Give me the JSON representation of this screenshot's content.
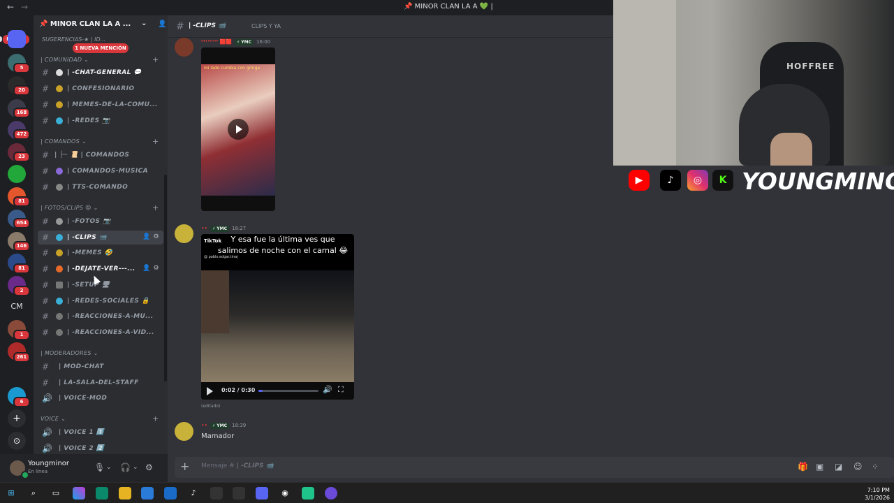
{
  "window": {
    "title": "📌 MINOR CLAN LA A 💚 |"
  },
  "rail": {
    "new_label": "NUEVO",
    "badges": [
      "5",
      "20",
      "168",
      "472",
      "23",
      "81",
      "654",
      "146",
      "81",
      "2",
      "1",
      "261",
      "6"
    ],
    "cm_label": "CM"
  },
  "server": {
    "name": "📌 MINOR CLAN LA A ...",
    "mention_badge": "1 NUEVA MENCIÓN"
  },
  "sidebar": {
    "top_partial": "SUGERENCIAS-★ | ID...",
    "categories": [
      {
        "name": "| COMUNIDAD",
        "channels": [
          "| -CHAT-GENERAL 💬",
          "| CONFESIONARIO",
          "| MEMES-DE-LA-COMU...",
          "| -REDES 📷"
        ]
      },
      {
        "name": "| COMANDOS",
        "channels": [
          "| ├─ 📜 | COMANDOS",
          "| COMANDOS-MUSICA",
          "| TTS-COMANDO"
        ]
      },
      {
        "name": "| FOTOS/CLIPS 😡",
        "channels": [
          "| -FOTOS 📷",
          "| -CLIPS 📹",
          "| -MEMES 🤣",
          "| -DEJATE-VER---...",
          "| -SETUP 🖥",
          "| -REDES-SOCIALES 🔒",
          "| -REACCIONES-A-MU...",
          "| -REACCIONES-A-VID..."
        ]
      },
      {
        "name": "| MODERADORES",
        "channels": [
          "| MOD-CHAT",
          "| LA-SALA-DEL-STAFF",
          "| VOICE-MOD"
        ]
      },
      {
        "name": "VOICE",
        "channels": [
          "| VOICE 1 1️⃣",
          "| VOICE 2 2️⃣"
        ]
      }
    ]
  },
  "user": {
    "name": "Youngminor",
    "status": "En línea"
  },
  "chat": {
    "channel_name": "| -CLIPS 📹",
    "topic": "CLIPS Y YA",
    "messages": [
      {
        "author": "ᴰᴱᴸᴵᴿᴵᵁᴹ 🟥🟥",
        "tag": "⚡ YMC",
        "time": "16:00",
        "video_caption": "mi lado cumbia con gringa"
      },
      {
        "author": "••",
        "tag": "⚡ YMC",
        "time": "18:27",
        "video_caption": "Y esa fue la última ves que salimos de noche  con el carnal 😂",
        "tiktok_label": "TikTok",
        "tiktok_user": "@ pablo.edgar.tinaj",
        "video_time": "0:02 / 0:30",
        "video_progress": 0.07,
        "edited": "(editado)"
      },
      {
        "author": "••",
        "tag": "⚡ YMC",
        "time": "18:39",
        "text": "Mamador"
      }
    ],
    "composer_placeholder": "Mensaje #",
    "composer_channel": "| -CLIPS 📹"
  },
  "stream_overlay": {
    "chair_text": "HOFFREE",
    "brand": "YOUNGMINOR",
    "social_icons": [
      "youtube-icon",
      "tiktok-icon",
      "instagram-icon",
      "kick-icon"
    ],
    "kick_letter": "K"
  },
  "taskbar": {
    "time": "7:10 PM",
    "date": "3/1/2026"
  },
  "colors": {
    "accent": "#5865f2",
    "badge": "#da373c",
    "online": "#23a55a"
  }
}
